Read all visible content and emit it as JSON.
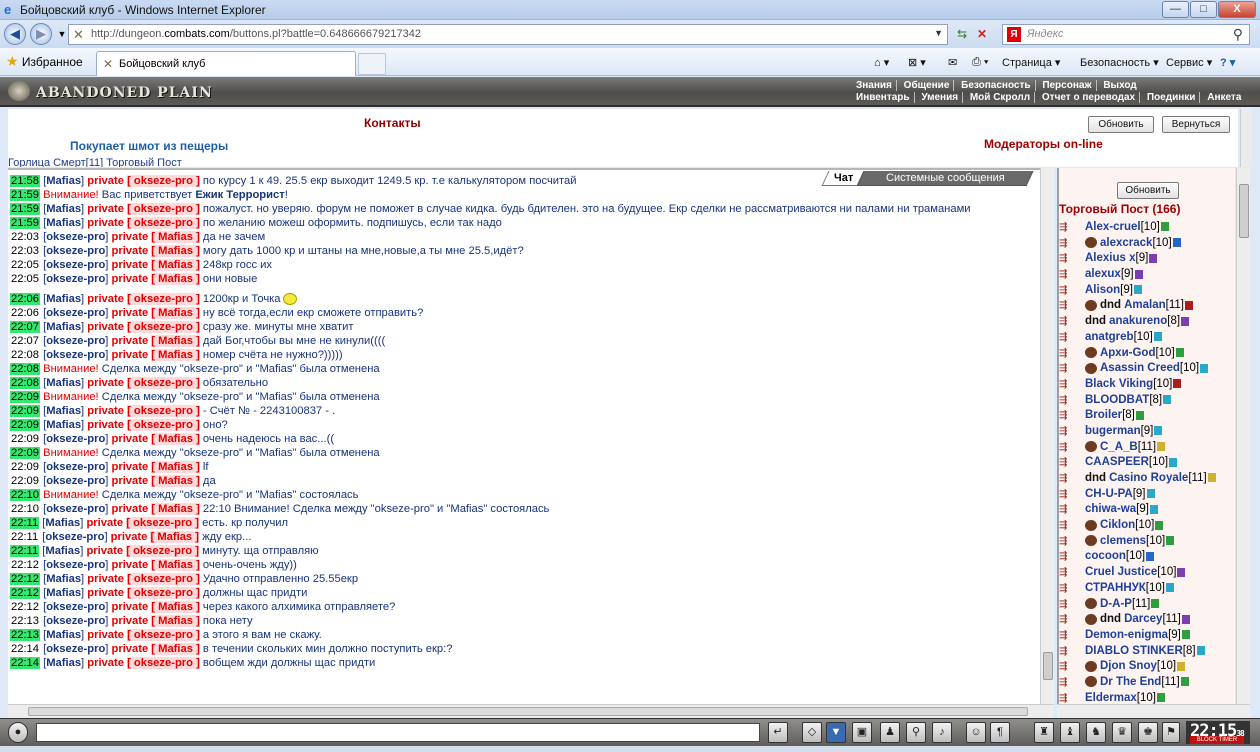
{
  "window": {
    "title": "Бойцовский клуб - Windows Internet Explorer",
    "min": "—",
    "max": "□",
    "close": "X"
  },
  "address": {
    "url_prefix": "http://dungeon.",
    "url_domain": "combats.com",
    "url_suffix": "/buttons.pl?battle=0.648666679217342",
    "search_placeholder": "Яндекс",
    "yandex_logo": "Я"
  },
  "favbar": {
    "favorites": "Избранное",
    "tab_title": "Бойцовский клуб",
    "page_menu": "Страница ▾",
    "security_menu": "Безопасность ▾",
    "service_menu": "Сервис ▾",
    "help_menu": "? ▾"
  },
  "game": {
    "logo": "ABANDONED PLAIN",
    "menu_row1": [
      "Знания",
      "Общение",
      "Безопасность",
      "Персонаж",
      "Выход"
    ],
    "menu_row2": [
      "Инвентарь",
      "Умения",
      "Мой Скролл",
      "Отчет о переводах",
      "Поединки",
      "Анкета"
    ]
  },
  "top": {
    "contacts": "Контакты",
    "buys": "Покупает шмот из пещеры",
    "moderators": "Модераторы on-line",
    "refresh": "Обновить",
    "back": "Вернуться",
    "fragment": "Горлица Смерт[11]   Торговый Пост"
  },
  "chat": {
    "tab_chat": "Чат",
    "tab_system": "Системные сообщения",
    "messages": [
      {
        "t": "21:58",
        "g": true,
        "from": "Mafias",
        "to": "okseze-pro",
        "text": "по курсу 1 к 49. 25.5 екр выходит 1249.5 кр. т.е калькулятором посчитай"
      },
      {
        "t": "21:59",
        "g": true,
        "attn": "Внимание!",
        "pre": "Вас приветствует ",
        "hl": "Ежик Террорист",
        "post": "!"
      },
      {
        "t": "21:59",
        "g": true,
        "from": "Mafias",
        "to": "okseze-pro",
        "text": "пожалуст. но уверяю. форум не поможет в случае кидка. будь бдителен. это на будущее. Екр сделки не рассматриваются ни палами ни траманами",
        "wrap": true
      },
      {
        "t": "21:59",
        "g": true,
        "from": "Mafias",
        "to": "okseze-pro",
        "text": "по желанию можеш оформить. подпишусь, если так надо"
      },
      {
        "t": "22:03",
        "g": false,
        "from": "okseze-pro",
        "to": "Mafias",
        "text": "да не зачем"
      },
      {
        "t": "22:03",
        "g": false,
        "from": "okseze-pro",
        "to": "Mafias",
        "text": "могу дать 1000 кр и штаны на мне,новые,а ты мне 25.5,идёт?"
      },
      {
        "t": "22:05",
        "g": false,
        "from": "okseze-pro",
        "to": "Mafias",
        "text": "248кр госс их"
      },
      {
        "t": "22:05",
        "g": false,
        "from": "okseze-pro",
        "to": "Mafias",
        "text": "они новые"
      },
      {
        "gap": true
      },
      {
        "t": "22:06",
        "g": true,
        "from": "Mafias",
        "to": "okseze-pro",
        "text": "1200кр и Точка",
        "smile": true
      },
      {
        "t": "22:06",
        "g": false,
        "from": "okseze-pro",
        "to": "Mafias",
        "text": "ну всё тогда,если екр сможете отправить?"
      },
      {
        "t": "22:07",
        "g": true,
        "from": "Mafias",
        "to": "okseze-pro",
        "text": "сразу же. минуты мне хватит"
      },
      {
        "t": "22:07",
        "g": false,
        "from": "okseze-pro",
        "to": "Mafias",
        "text": "дай Бог,чтобы вы мне не кинули(((("
      },
      {
        "t": "22:08",
        "g": false,
        "from": "okseze-pro",
        "to": "Mafias",
        "text": "номер счёта не нужно?)))))"
      },
      {
        "t": "22:08",
        "g": true,
        "attn": "Внимание!",
        "pre": "Сделка между \"okseze-pro\" и \"Mafias\" была отменена"
      },
      {
        "t": "22:08",
        "g": true,
        "from": "Mafias",
        "to": "okseze-pro",
        "text": "обязательно"
      },
      {
        "t": "22:09",
        "g": true,
        "attn": "Внимание!",
        "pre": "Сделка между \"okseze-pro\" и \"Mafias\" была отменена"
      },
      {
        "t": "22:09",
        "g": true,
        "from": "Mafias",
        "to": "okseze-pro",
        "text": "- Счёт № - 2243100837 - ."
      },
      {
        "t": "22:09",
        "g": true,
        "from": "Mafias",
        "to": "okseze-pro",
        "text": "оно?"
      },
      {
        "t": "22:09",
        "g": false,
        "from": "okseze-pro",
        "to": "Mafias",
        "text": "очень надеюсь на вас...(("
      },
      {
        "t": "22:09",
        "g": true,
        "attn": "Внимание!",
        "pre": "Сделка между \"okseze-pro\" и \"Mafias\" была отменена"
      },
      {
        "t": "22:09",
        "g": false,
        "from": "okseze-pro",
        "to": "Mafias",
        "text": "lf"
      },
      {
        "t": "22:09",
        "g": false,
        "from": "okseze-pro",
        "to": "Mafias",
        "text": "да"
      },
      {
        "t": "22:10",
        "g": true,
        "attn": "Внимание!",
        "pre": "Сделка между \"okseze-pro\" и \"Mafias\" состоялась"
      },
      {
        "t": "22:10",
        "g": false,
        "from": "okseze-pro",
        "to": "Mafias",
        "text": "22:10 Внимание! Сделка между \"okseze-pro\" и \"Mafias\" состоялась"
      },
      {
        "t": "22:11",
        "g": true,
        "from": "Mafias",
        "to": "okseze-pro",
        "text": "есть. кр получил"
      },
      {
        "t": "22:11",
        "g": false,
        "from": "okseze-pro",
        "to": "Mafias",
        "text": "жду екр..."
      },
      {
        "t": "22:11",
        "g": true,
        "from": "Mafias",
        "to": "okseze-pro",
        "text": "минуту. ща отправляю"
      },
      {
        "t": "22:12",
        "g": false,
        "from": "okseze-pro",
        "to": "Mafias",
        "text": "очень-очень жду))"
      },
      {
        "t": "22:12",
        "g": true,
        "from": "Mafias",
        "to": "okseze-pro",
        "text": "Удачно отправленно 25.55екр"
      },
      {
        "t": "22:12",
        "g": true,
        "from": "Mafias",
        "to": "okseze-pro",
        "text": "должны щас придти"
      },
      {
        "t": "22:12",
        "g": false,
        "from": "okseze-pro",
        "to": "Mafias",
        "text": "через какого алхимика отправляете?"
      },
      {
        "t": "22:13",
        "g": false,
        "from": "okseze-pro",
        "to": "Mafias",
        "text": "пока нету"
      },
      {
        "t": "22:13",
        "g": true,
        "from": "Mafias",
        "to": "okseze-pro",
        "text": "а этого я вам не скажу."
      },
      {
        "t": "22:14",
        "g": false,
        "from": "okseze-pro",
        "to": "Mafias",
        "text": "в течении скольких мин должно поступить екр:?"
      },
      {
        "t": "22:14",
        "g": true,
        "from": "Mafias",
        "to": "okseze-pro",
        "text": "вобщем жди должны щас придти"
      }
    ]
  },
  "right_panel": {
    "refresh": "Обновить",
    "title": "Торговый Пост (166)",
    "players": [
      {
        "name": "Alex-cruel",
        "lvl": "[10]",
        "ib": "#2e9e3e"
      },
      {
        "name": "alexcrack",
        "lvl": "[10]",
        "icon": true,
        "ib": "#2568c8"
      },
      {
        "name": "Alexius x",
        "lvl": "[9]",
        "ib": "#7a3fb0"
      },
      {
        "name": "alexux",
        "lvl": "[9]",
        "ib": "#7a3fb0"
      },
      {
        "name": "Alison",
        "lvl": "[9]",
        "ib": "#2aa8c8"
      },
      {
        "name": "Amalan",
        "lvl": "[11]",
        "dnd": true,
        "icon": true,
        "ib": "#b01c1c"
      },
      {
        "name": "anakureno",
        "lvl": "[8]",
        "dnd": true,
        "ib": "#7a3fb0"
      },
      {
        "name": "anatgreb",
        "lvl": "[10]",
        "ib": "#2aa8c8"
      },
      {
        "name": "Архи-God",
        "lvl": "[10]",
        "icon": true,
        "ib": "#2e9e3e"
      },
      {
        "name": "Asassin Creed",
        "lvl": "[10]",
        "icon": true,
        "ib": "#2aa8c8"
      },
      {
        "name": "Black Viking",
        "lvl": "[10]",
        "ib": "#b01c1c"
      },
      {
        "name": "BLOODBAT",
        "lvl": "[8]",
        "ib": "#2aa8c8"
      },
      {
        "name": "Broiler",
        "lvl": "[8]",
        "ib": "#2e9e3e"
      },
      {
        "name": "bugerman",
        "lvl": "[9]",
        "ib": "#2aa8c8"
      },
      {
        "name": "C_A_B",
        "lvl": "[11]",
        "icon": true,
        "ib": "#d0b030"
      },
      {
        "name": "CAASPEER",
        "lvl": "[10]",
        "ib": "#2aa8c8"
      },
      {
        "name": "Casino Royale",
        "lvl": "[11]",
        "dnd": true,
        "ib": "#d0b030"
      },
      {
        "name": "CH-U-PA",
        "lvl": "[9]",
        "ib": "#2aa8c8"
      },
      {
        "name": "chiwa-wa",
        "lvl": "[9]",
        "ib": "#2aa8c8"
      },
      {
        "name": "Ciklon",
        "lvl": "[10]",
        "icon": true,
        "ib": "#2e9e3e"
      },
      {
        "name": "clemens",
        "lvl": "[10]",
        "icon": true,
        "ib": "#2e9e3e"
      },
      {
        "name": "cocoon",
        "lvl": "[10]",
        "ib": "#2568c8"
      },
      {
        "name": "Cruel Justice",
        "lvl": "[10]",
        "ib": "#7a3fb0"
      },
      {
        "name": "СТРАННУК",
        "lvl": "[10]",
        "ib": "#2aa8c8"
      },
      {
        "name": "D-A-P",
        "lvl": "[11]",
        "icon": true,
        "ib": "#2e9e3e"
      },
      {
        "name": "Darcey",
        "lvl": "[11]",
        "dnd": true,
        "icon": true,
        "ib": "#7a3fb0"
      },
      {
        "name": "Demon-enigma",
        "lvl": "[9]",
        "ib": "#2e9e3e"
      },
      {
        "name": "DIABLO STINKER",
        "lvl": "[8]",
        "ib": "#2aa8c8"
      },
      {
        "name": "Djon Snoy",
        "lvl": "[10]",
        "icon": true,
        "ib": "#d0b030"
      },
      {
        "name": "Dr The End",
        "lvl": "[11]",
        "icon": true,
        "ib": "#2e9e3e"
      },
      {
        "name": "Eldermax",
        "lvl": "[10]",
        "ib": "#2e9e3e"
      }
    ]
  },
  "bottom": {
    "clock": "22:15",
    "clock_sec": "38",
    "clock_label": "BLOCK TIMER"
  },
  "colors": {
    "timestamp_green": "#35e66f",
    "private_red": "#e40000",
    "nick_blue": "#19347e"
  }
}
